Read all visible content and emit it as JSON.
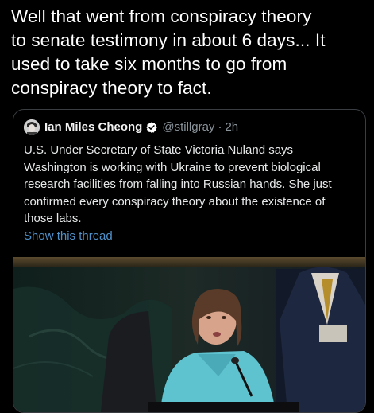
{
  "main_text": {
    "line1": "Well that went from conspiracy theory",
    "line2": "to senate testimony in about 6 days... It",
    "line3": "used to take six months to go from",
    "line4": "conspiracy theory to fact."
  },
  "quoted_tweet": {
    "author_name": "Ian Miles Cheong",
    "handle": "@stillgray",
    "separator": "·",
    "time": "2h",
    "body": "U.S. Under Secretary of State Victoria Nuland says Washington is working with Ukraine to prevent biological research facilities from falling into Russian hands. She just confirmed every conspiracy theory about the existence of those labs.",
    "show_thread_label": "Show this thread",
    "avatar_icon": "avatar-portrait",
    "verified_icon": "verified-badge-icon",
    "media_description_icon": "hearing-photo"
  },
  "colors": {
    "background": "#000000",
    "text_primary": "#ffffff",
    "text_secondary": "#8b949b",
    "link": "#4e90c9",
    "verified_badge": "#ffffff",
    "card_border": "#3a3d41"
  }
}
